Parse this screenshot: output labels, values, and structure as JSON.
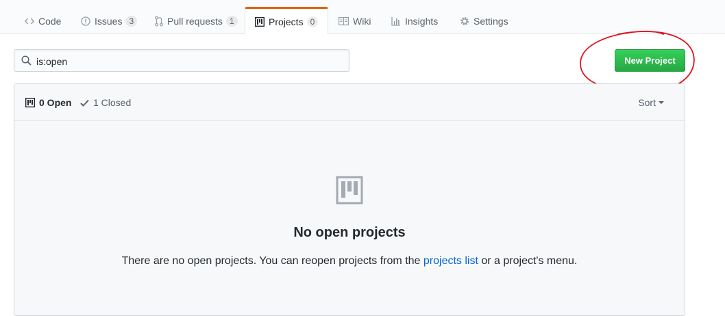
{
  "tabs": [
    {
      "label": "Code",
      "icon": "code-icon"
    },
    {
      "label": "Issues",
      "count": "3",
      "icon": "issue-icon"
    },
    {
      "label": "Pull requests",
      "count": "1",
      "icon": "pull-request-icon"
    },
    {
      "label": "Projects",
      "count": "0",
      "icon": "project-icon",
      "selected": true
    },
    {
      "label": "Wiki",
      "icon": "book-icon"
    },
    {
      "label": "Insights",
      "icon": "graph-icon"
    },
    {
      "label": "Settings",
      "icon": "gear-icon"
    }
  ],
  "search": {
    "value": "is:open",
    "icon": "search-icon"
  },
  "new_project_label": "New Project",
  "annotation_color": "#e0141e",
  "accent_color": "#e36209",
  "header": {
    "open_label": "0 Open",
    "closed_label": "1 Closed",
    "sort_label": "Sort"
  },
  "blankslate": {
    "title": "No open projects",
    "text_before": "There are no open projects. You can reopen projects from the ",
    "link": "projects list",
    "text_after": " or a project's menu."
  }
}
